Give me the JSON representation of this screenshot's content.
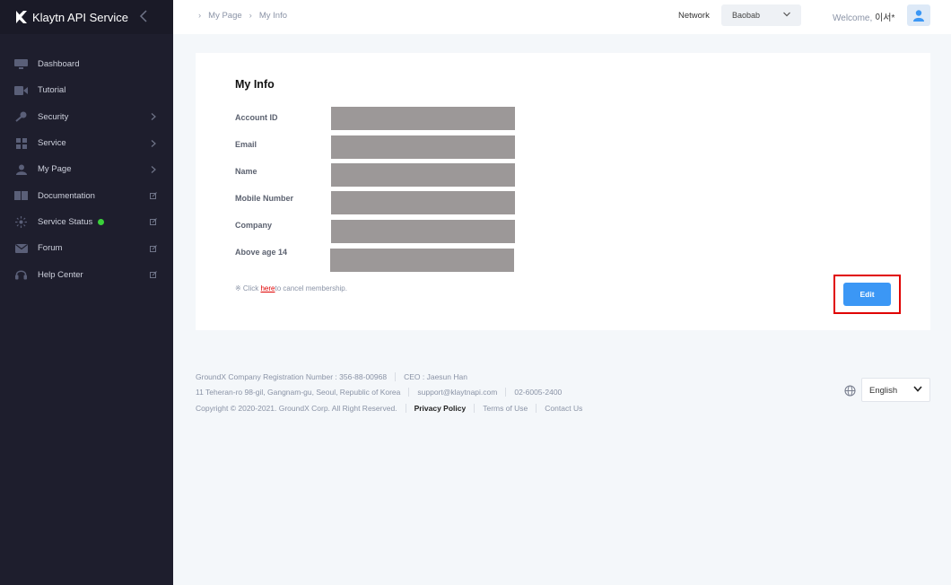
{
  "app": {
    "title": "Klaytn API Service"
  },
  "sidebar": {
    "items": [
      {
        "label": "Dashboard",
        "icon": "dashboard-icon",
        "right": ""
      },
      {
        "label": "Tutorial",
        "icon": "video-icon",
        "right": ""
      },
      {
        "label": "Security",
        "icon": "key-icon",
        "right": "chevron-right-icon"
      },
      {
        "label": "Service",
        "icon": "grid-icon",
        "right": "chevron-right-icon"
      },
      {
        "label": "My Page",
        "icon": "user-icon",
        "right": "chevron-right-icon"
      },
      {
        "label": "Documentation",
        "icon": "book-icon",
        "right": "external-link-icon"
      },
      {
        "label": "Service Status",
        "icon": "sun-icon",
        "right": "external-link-icon",
        "status_color": "#3ad13a"
      },
      {
        "label": "Forum",
        "icon": "mail-icon",
        "right": "external-link-icon"
      },
      {
        "label": "Help Center",
        "icon": "headset-icon",
        "right": "external-link-icon"
      }
    ]
  },
  "header": {
    "breadcrumb": [
      "My Page",
      "My Info"
    ],
    "network_label": "Network",
    "network_value": "Baobab",
    "welcome_prefix": "Welcome,",
    "welcome_name": "이서*"
  },
  "card": {
    "title": "My Info",
    "fields": [
      {
        "label": "Account ID"
      },
      {
        "label": "Email"
      },
      {
        "label": "Name"
      },
      {
        "label": "Mobile Number"
      },
      {
        "label": "Company"
      },
      {
        "label": "Above age 14"
      }
    ],
    "note_prefix": "※ Click ",
    "note_link": "here",
    "note_suffix": "to cancel membership.",
    "edit_label": "Edit"
  },
  "footer": {
    "reg_number": "GroundX Company Registration Number : 356-88-00968",
    "ceo": "CEO : Jaesun Han",
    "address": "11 Teheran-ro 98-gil, Gangnam-gu, Seoul, Republic of Korea",
    "email": "support@klaytnapi.com",
    "phone": "02-6005-2400",
    "copyright": "Copyright © 2020-2021. GroundX Corp. All Right Reserved.",
    "privacy": "Privacy Policy",
    "terms": "Terms of Use",
    "contact": "Contact Us",
    "language": "English"
  },
  "colors": {
    "sidebar_bg": "#1e1e2d",
    "accent": "#3b97f5",
    "highlight": "#e00000",
    "redacted": "#9c9898"
  }
}
